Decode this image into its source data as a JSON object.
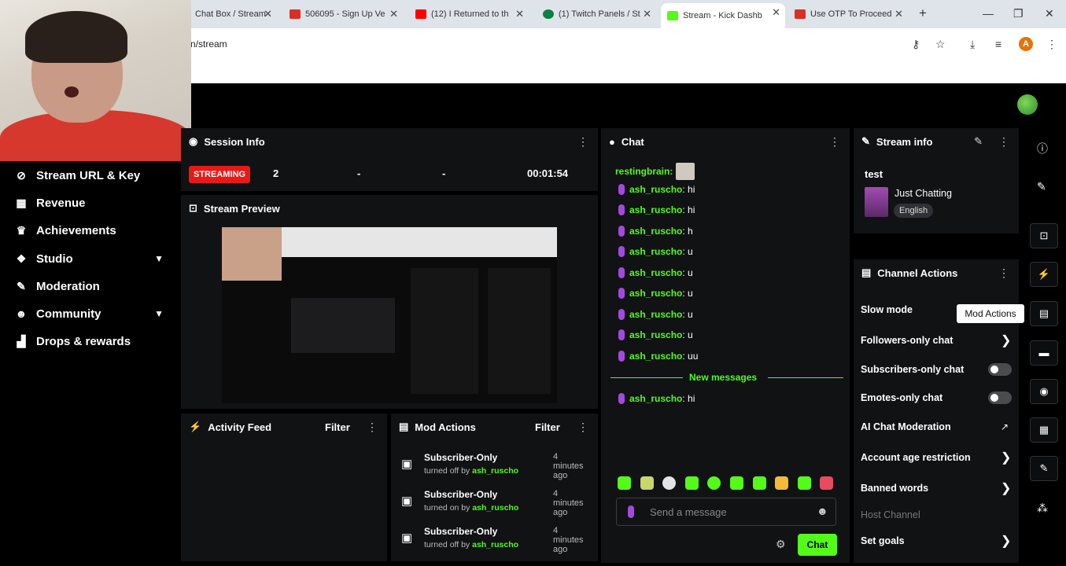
{
  "browser": {
    "tabs": [
      {
        "label": "Chat Box / Stream",
        "color": "#2c6bd6"
      },
      {
        "label": "506095 - Sign Up Ve",
        "color": "#d93025"
      },
      {
        "label": "(12) I Returned to th",
        "color": "#ff0000"
      },
      {
        "label": "(1) Twitch Panels / St",
        "color": "#0b8043"
      },
      {
        "label": "Stream - Kick Dashb",
        "color": "#53fc18"
      },
      {
        "label": "Use OTP To Proceed",
        "color": "#d93025"
      }
    ],
    "url": "n/stream",
    "profile_initial": "A"
  },
  "sidebar": {
    "items": [
      {
        "label": "Stream URL & Key",
        "icon": "link-icon"
      },
      {
        "label": "Revenue",
        "icon": "chart-icon"
      },
      {
        "label": "Achievements",
        "icon": "trophy-icon"
      },
      {
        "label": "Studio",
        "icon": "studio-icon"
      },
      {
        "label": "Moderation",
        "icon": "wrench-icon"
      },
      {
        "label": "Community",
        "icon": "users-icon"
      },
      {
        "label": "Drops & rewards",
        "icon": "gift-icon"
      }
    ]
  },
  "session": {
    "title": "Session Info",
    "status": "STREAMING",
    "viewers": "2",
    "stat2": "-",
    "stat3": "-",
    "duration": "00:01:54"
  },
  "preview": {
    "title": "Stream Preview"
  },
  "activity": {
    "title": "Activity Feed",
    "filter": "Filter"
  },
  "mod_actions": {
    "title": "Mod Actions",
    "filter": "Filter",
    "rows": [
      {
        "action": "Subscriber-Only",
        "detail": "turned off by",
        "user": "ash_ruscho",
        "time": "4 minutes ago"
      },
      {
        "action": "Subscriber-Only",
        "detail": "turned on by",
        "user": "ash_ruscho",
        "time": "4 minutes ago"
      },
      {
        "action": "Subscriber-Only",
        "detail": "turned off by",
        "user": "ash_ruscho",
        "time": "4 minutes ago"
      }
    ]
  },
  "chat": {
    "title": "Chat",
    "pinned_user": "restingbrain:",
    "messages": [
      {
        "user": "ash_ruscho",
        "text": ": hi"
      },
      {
        "user": "ash_ruscho",
        "text": ": hi"
      },
      {
        "user": "ash_ruscho",
        "text": ": h"
      },
      {
        "user": "ash_ruscho",
        "text": ": u"
      },
      {
        "user": "ash_ruscho",
        "text": ": u"
      },
      {
        "user": "ash_ruscho",
        "text": ": u"
      },
      {
        "user": "ash_ruscho",
        "text": ": u"
      },
      {
        "user": "ash_ruscho",
        "text": ": u"
      },
      {
        "user": "ash_ruscho",
        "text": ": uu"
      }
    ],
    "new_messages_label": "New messages",
    "after_messages": [
      {
        "user": "ash_ruscho",
        "text": ": hi"
      }
    ],
    "input_placeholder": "Send a message",
    "send_label": "Chat"
  },
  "stream_info": {
    "title": "Stream info",
    "stream_title": "test",
    "category": "Just Chatting",
    "language": "English"
  },
  "channel_actions": {
    "title": "Channel Actions",
    "items": [
      "Slow mode",
      "Followers-only chat",
      "Subscribers-only chat",
      "Emotes-only chat",
      "AI Chat Moderation",
      "Account age restriction",
      "Banned words",
      "Host Channel",
      "Set goals"
    ]
  },
  "tooltip": "Mod Actions",
  "accent_color": "#53fc18"
}
